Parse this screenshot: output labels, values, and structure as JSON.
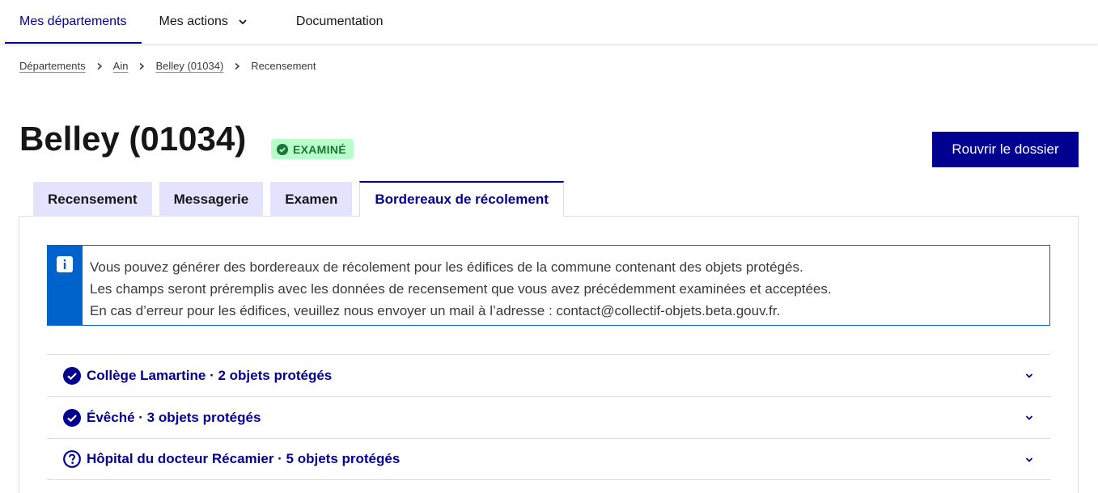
{
  "nav": {
    "items": [
      {
        "label": "Mes départements",
        "active": true
      },
      {
        "label": "Mes actions",
        "has_dropdown": true
      },
      {
        "label": "Documentation"
      }
    ]
  },
  "breadcrumb": {
    "links": [
      "Départements",
      "Ain",
      "Belley (01034)"
    ],
    "current": "Recensement"
  },
  "page": {
    "title": "Belley (01034)",
    "status_badge": "EXAMINÉ",
    "reopen_button": "Rouvrir le dossier"
  },
  "tabs": [
    {
      "label": "Recensement"
    },
    {
      "label": "Messagerie"
    },
    {
      "label": "Examen"
    },
    {
      "label": "Bordereaux de récolement",
      "active": true
    }
  ],
  "alert": {
    "icon": "info-icon",
    "lines": [
      "Vous pouvez générer des bordereaux de récolement pour les édifices de la commune contenant des objets protégés.",
      "Les champs seront préremplis avec les données de recensement que vous avez précédemment examinées et acceptées.",
      "En cas d’erreur pour les édifices, veuillez nous envoyer un mail à l’adresse : contact@collectif-objets.beta.gouv.fr."
    ]
  },
  "edifices": [
    {
      "label": "Collège Lamartine · 2 objets protégés",
      "status": "check-circle-icon"
    },
    {
      "label": "Évêché · 3 objets protégés",
      "status": "check-circle-icon"
    },
    {
      "label": "Hôpital du docteur Récamier · 5 objets protégés",
      "status": "question-circle-icon"
    }
  ],
  "colors": {
    "primary": "#000091",
    "info": "#0063cb",
    "success_bg": "#b8fec9",
    "success_text": "#18753c",
    "tab_bg": "#e3e3fd"
  }
}
